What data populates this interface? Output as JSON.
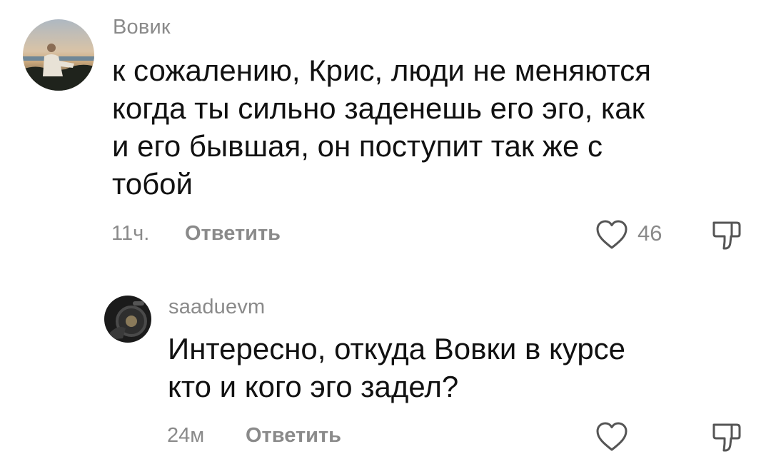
{
  "comments": [
    {
      "username": "Вовик",
      "lines": [
        "к сожалению, Крис, люди не меняются",
        "когда ты сильно заденешь его эго, как",
        "и его бывшая, он поступит так же с",
        "тобой"
      ],
      "time": "11ч.",
      "reply_label": "Ответить",
      "likes": "46"
    },
    {
      "username": "saaduevm",
      "lines": [
        "Интересно, откуда Вовки в курсе",
        "кто и кого эго задел?"
      ],
      "time": "24м",
      "reply_label": "Ответить"
    }
  ],
  "icons": {
    "like": "heart-outline-icon",
    "dislike": "thumbs-down-outline-icon"
  },
  "colors": {
    "text": "#111111",
    "muted": "#8a8a8a",
    "background": "#ffffff"
  }
}
